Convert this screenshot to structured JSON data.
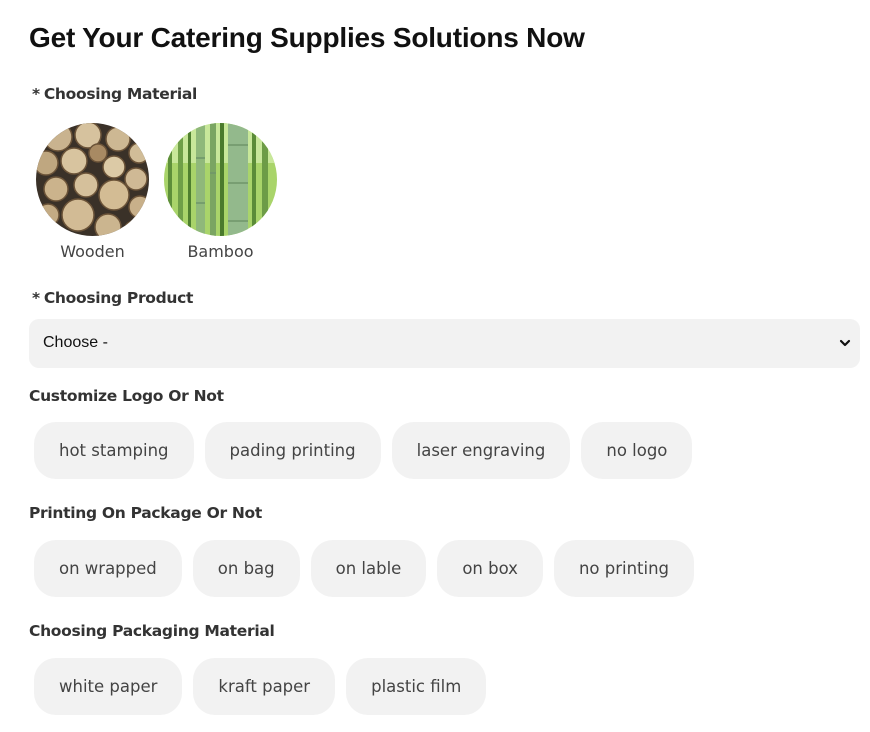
{
  "page": {
    "title": "Get Your Catering Supplies Solutions Now"
  },
  "material": {
    "label": "Choosing Material",
    "required_mark": "*",
    "options": [
      {
        "name": "Wooden",
        "image": "stacked-logs-image"
      },
      {
        "name": "Bamboo",
        "image": "bamboo-forest-image"
      }
    ]
  },
  "product": {
    "label": "Choosing Product",
    "required_mark": "*",
    "selected": "Choose -",
    "icon": "chevron-down-icon"
  },
  "logo": {
    "label": "Customize Logo Or Not",
    "options": [
      "hot stamping",
      "pading printing",
      "laser engraving",
      "no logo"
    ]
  },
  "package_printing": {
    "label": "Printing On Package Or Not",
    "options": [
      "on wrapped",
      "on bag",
      "on lable",
      "on box",
      "no printing"
    ]
  },
  "packaging_material": {
    "label": "Choosing Packaging Material",
    "options": [
      "white paper",
      "kraft paper",
      "plastic film"
    ]
  },
  "colors": {
    "chip_bg": "#f2f2f2",
    "text": "#444444"
  }
}
